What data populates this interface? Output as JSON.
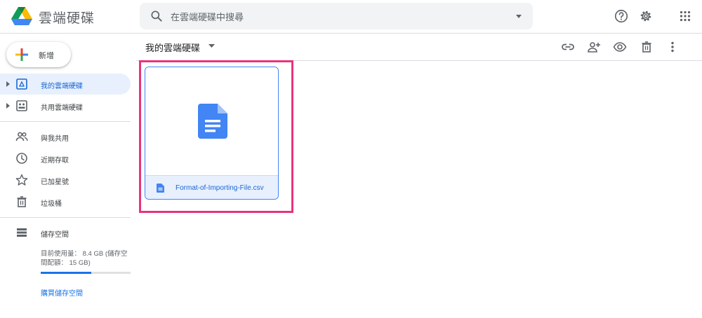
{
  "header": {
    "app_title": "雲端硬碟",
    "search_placeholder": "在雲端硬碟中搜尋",
    "icons": [
      "drive-logo",
      "search-icon",
      "search-options-icon",
      "help-icon",
      "settings-icon",
      "apps-grid-icon"
    ]
  },
  "sidebar": {
    "new_label": "新增",
    "items": [
      {
        "label": "我的雲端硬碟",
        "icon": "my-drive-icon",
        "active": true,
        "expandable": true
      },
      {
        "label": "共用雲端硬碟",
        "icon": "shared-drives-icon",
        "active": false,
        "expandable": true
      },
      {
        "label": "與我共用",
        "icon": "shared-with-me-icon",
        "active": false,
        "expandable": false
      },
      {
        "label": "近期存取",
        "icon": "recent-icon",
        "active": false,
        "expandable": false
      },
      {
        "label": "已加星號",
        "icon": "starred-icon",
        "active": false,
        "expandable": false
      },
      {
        "label": "垃圾桶",
        "icon": "trash-icon",
        "active": false,
        "expandable": false
      }
    ],
    "storage": {
      "label": "儲存空間",
      "usage_line1": "目前使用量： 8.4 GB (儲存空",
      "usage_line2": "間配額： 15 GB)",
      "used_fraction": 0.56,
      "buy_label": "購買儲存空間"
    }
  },
  "main": {
    "breadcrumb": "我的雲端硬碟",
    "toolbar_icons": [
      "link-icon",
      "share-icon",
      "preview-icon",
      "delete-icon",
      "more-icon"
    ],
    "files": [
      {
        "name": "Format-of-Importing-File.csv",
        "type": "document",
        "selected": true
      }
    ]
  },
  "colors": {
    "accent": "#1a73e8",
    "active_bg": "#e8f0fe",
    "highlight": "#e8347c",
    "doc_blue": "#4285f4"
  }
}
